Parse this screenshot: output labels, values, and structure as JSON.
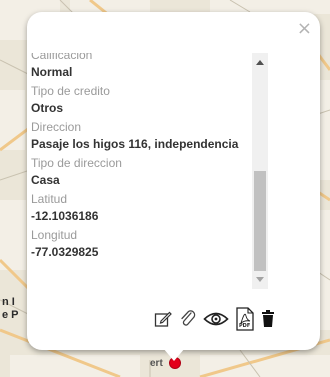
{
  "map": {
    "side_labels": [
      "n I",
      "e P"
    ],
    "bottom_label": "ert"
  },
  "popup": {
    "close_glyph": "×",
    "fields": [
      {
        "label": "Calificacion",
        "value": "Normal"
      },
      {
        "label": "Tipo de credito",
        "value": "Otros"
      },
      {
        "label": "Direccion",
        "value": "Pasaje los higos 116, independencia"
      },
      {
        "label": "Tipo de direccion",
        "value": "Casa"
      },
      {
        "label": "Latitud",
        "value": "-12.1036186"
      },
      {
        "label": "Longitud",
        "value": "-77.0329825"
      }
    ],
    "actions": [
      "edit-icon",
      "attachment-icon",
      "view-icon",
      "pdf-icon",
      "trash-icon"
    ],
    "pdf_badge": "PDF"
  },
  "colors": {
    "marker": "#e3001b",
    "label": "#9a9a9a",
    "value": "#333333"
  }
}
